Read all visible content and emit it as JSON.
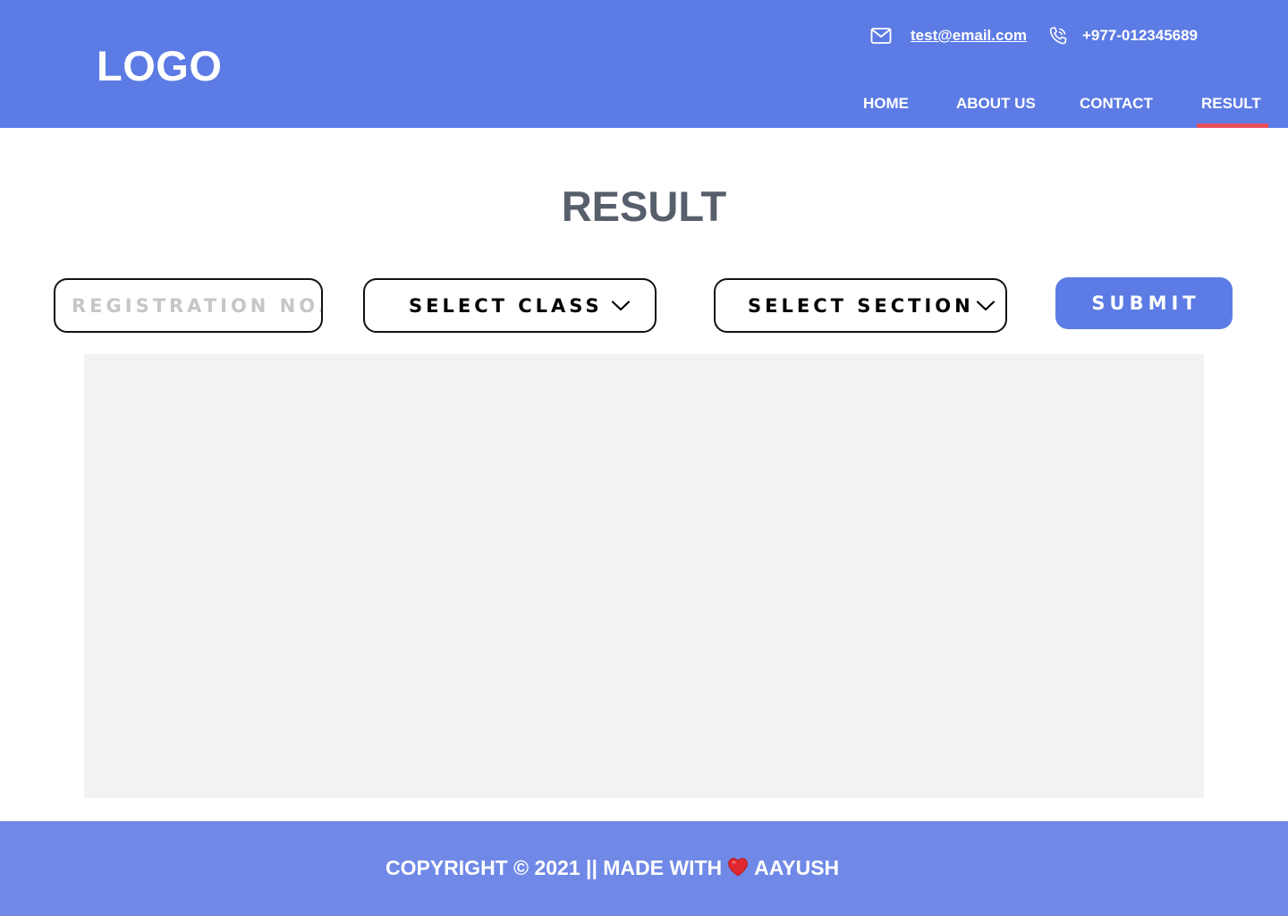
{
  "header": {
    "logo": "LOGO",
    "email": "test@email.com",
    "phone": "+977-012345689",
    "email_icon": "mail-icon",
    "phone_icon": "phone-icon"
  },
  "nav": {
    "items": [
      {
        "label": "HOME"
      },
      {
        "label": "ABOUT US"
      },
      {
        "label": "CONTACT"
      },
      {
        "label": "RESULT",
        "active": true
      }
    ]
  },
  "main": {
    "title": "RESULT",
    "registration_placeholder": "REGISTRATION NO.",
    "registration_value": "",
    "select_class": "SELECT CLASS",
    "select_section": "SELECT SECTION",
    "submit_label": "SUBMIT",
    "chevron_icon": "chevron-down-icon"
  },
  "footer": {
    "text_before": "COPYRIGHT © 2021 || MADE WITH",
    "heart_icon": "heart-icon",
    "text_after": "AAYUSH"
  },
  "colors": {
    "header_bg": "#5c7be4",
    "footer_bg": "#7089e6",
    "accent": "#5c7be4",
    "active_underline": "#e8505b",
    "title": "#575f6c",
    "panel_bg": "#f2f2f2"
  }
}
